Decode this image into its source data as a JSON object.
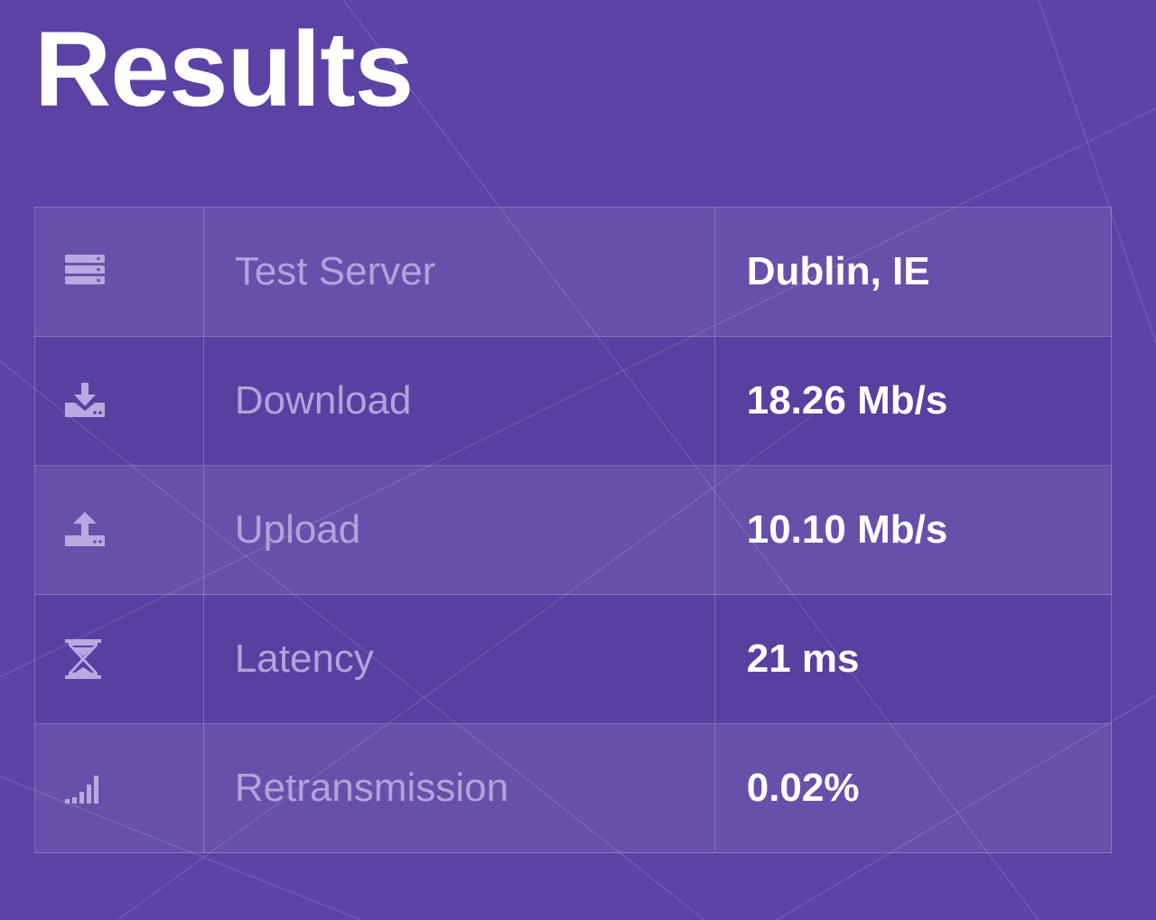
{
  "title": "Results",
  "colors": {
    "background": "#5b42a4",
    "label_text": "#b1a3dc",
    "value_text": "#ffffff",
    "icon": "#b8a9e0"
  },
  "rows": [
    {
      "icon": "server-icon",
      "label": "Test Server",
      "value": "Dublin, IE"
    },
    {
      "icon": "download-icon",
      "label": "Download",
      "value": "18.26 Mb/s"
    },
    {
      "icon": "upload-icon",
      "label": "Upload",
      "value": "10.10 Mb/s"
    },
    {
      "icon": "hourglass-icon",
      "label": "Latency",
      "value": "21 ms"
    },
    {
      "icon": "signal-bars-icon",
      "label": "Retransmission",
      "value": "0.02%"
    }
  ]
}
